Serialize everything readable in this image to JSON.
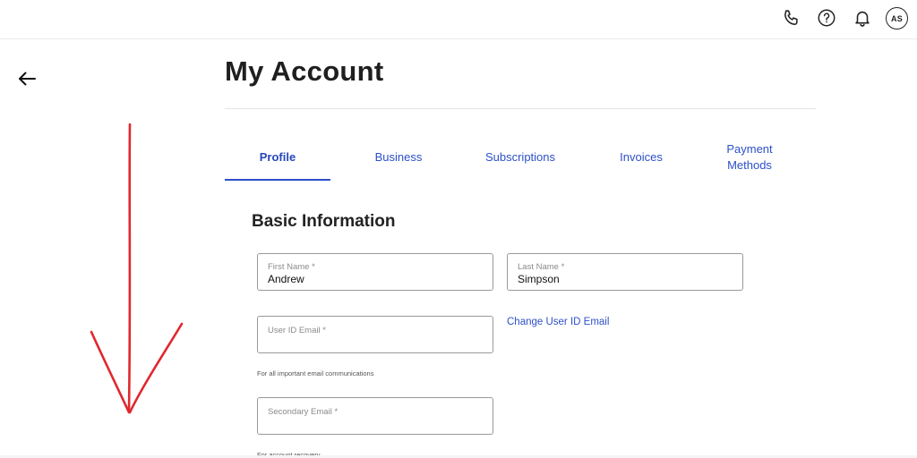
{
  "header": {
    "icons": [
      "phone-icon",
      "help-icon",
      "bell-icon"
    ],
    "avatar_initials": "AS"
  },
  "page": {
    "title": "My Account",
    "back_icon": "arrow-left-icon"
  },
  "tabs": [
    {
      "label": "Profile",
      "active": true
    },
    {
      "label": "Business",
      "active": false
    },
    {
      "label": "Subscriptions",
      "active": false
    },
    {
      "label": "Invoices",
      "active": false
    },
    {
      "label": "Payment Methods",
      "active": false
    }
  ],
  "basic_info": {
    "title": "Basic Information",
    "first_name": {
      "label": "First Name *",
      "value": "Andrew"
    },
    "last_name": {
      "label": "Last Name *",
      "value": "Simpson"
    },
    "user_id_email": {
      "label": "User ID Email *",
      "value": "",
      "helper": "For all important email communications"
    },
    "change_email_link": "Change User ID Email",
    "secondary_email": {
      "label": "Secondary Email *",
      "value": "",
      "helper": "For account recovery"
    }
  },
  "colors": {
    "accent": "#2d50c8",
    "annotation": "#e0282e"
  }
}
